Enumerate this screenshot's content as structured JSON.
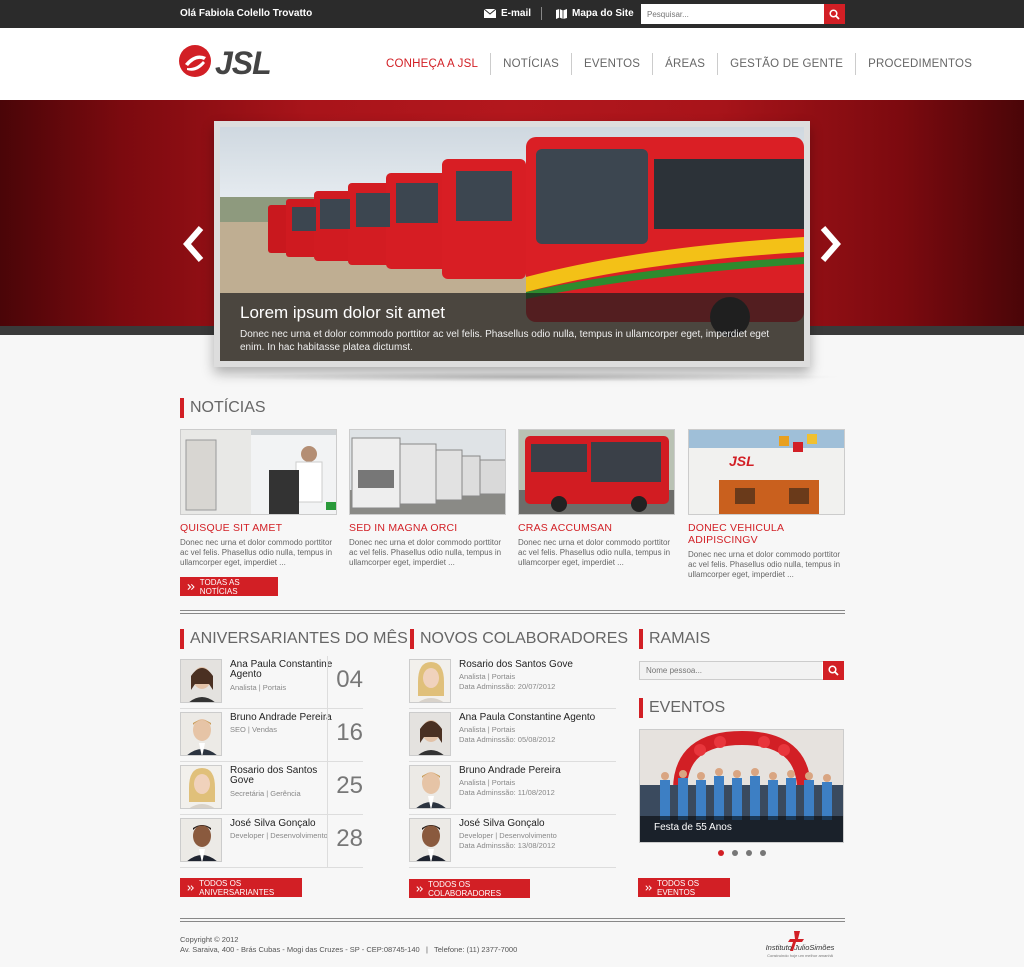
{
  "topbar": {
    "greeting": "Olá Fabiola Colello Trovatto",
    "email_label": "E-mail",
    "sitemap_label": "Mapa do Site",
    "search_placeholder": "Pesquisar..."
  },
  "nav": {
    "items": [
      "CONHEÇA A JSL",
      "NOTÍCIAS",
      "EVENTOS",
      "ÁREAS",
      "GESTÃO DE GENTE",
      "PROCEDIMENTOS"
    ]
  },
  "slider": {
    "title": "Lorem ipsum dolor sit amet",
    "text": "Donec nec urna et dolor commodo porttitor ac vel felis. Phasellus odio nulla, tempus in ullamcorper eget, imperdiet eget enim. In hac habitasse platea dictumst."
  },
  "news": {
    "title": "NOTÍCIAS",
    "items": [
      {
        "title": "QUISQUE SIT AMET",
        "text": "Donec nec urna et dolor commodo porttitor ac vel felis. Phasellus odio nulla, tempus in ullamcorper eget, imperdiet ..."
      },
      {
        "title": "SED IN MAGNA ORCI",
        "text": "Donec nec urna et dolor commodo porttitor ac vel felis. Phasellus odio nulla, tempus in ullamcorper eget, imperdiet ..."
      },
      {
        "title": "CRAS ACCUMSAN",
        "text": "Donec nec urna et dolor commodo porttitor ac vel felis. Phasellus odio nulla, tempus in ullamcorper eget, imperdiet ..."
      },
      {
        "title": "DONEC VEHICULA ADIPISCINGV",
        "text": "Donec nec urna et dolor commodo porttitor ac vel felis. Phasellus odio nulla, tempus in ullamcorper eget, imperdiet ..."
      }
    ],
    "all_button": "TODAS AS NOTÍCIAS"
  },
  "birthdays": {
    "title": "ANIVERSARIANTES DO MÊS",
    "items": [
      {
        "name": "Ana Paula Constantine Agento",
        "role": "Analista | Portais",
        "day": "04"
      },
      {
        "name": "Bruno Andrade Pereira",
        "role": "SEO | Vendas",
        "day": "16"
      },
      {
        "name": "Rosario dos Santos Gove",
        "role": "Secretária | Gerência",
        "day": "25"
      },
      {
        "name": "José Silva Gonçalo",
        "role": "Developer | Desenvolvimento",
        "day": "28"
      }
    ],
    "all_button": "TODOS OS ANIVERSARIANTES"
  },
  "newcomers": {
    "title": "NOVOS COLABORADORES",
    "items": [
      {
        "name": "Rosario dos Santos Gove",
        "role": "Analista | Portais",
        "date": "Data Adminssão: 20/07/2012"
      },
      {
        "name": "Ana Paula Constantine Agento",
        "role": "Analista | Portais",
        "date": "Data Adminssão: 05/08/2012"
      },
      {
        "name": "Bruno Andrade Pereira",
        "role": "Analista | Portais",
        "date": "Data Adminssão: 11/08/2012"
      },
      {
        "name": "José Silva Gonçalo",
        "role": "Developer | Desenvolvimento",
        "date": "Data Adminssão: 13/08/2012"
      }
    ],
    "all_button": "TODOS OS COLABORADORES"
  },
  "ramais": {
    "title": "RAMAIS",
    "placeholder": "Nome pessoa..."
  },
  "events": {
    "title": "EVENTOS",
    "caption": "Festa de 55 Anos",
    "all_button": "TODOS OS EVENTOS"
  },
  "footer": {
    "copyright": "Copyright © 2012",
    "address": "Av. Saraiva, 400 - Brás Cubas - Mogi das Cruzes - SP - CEP:08745-140   |   Telefone: (11) 2377-7000",
    "logo_text": "Instituto JulioSimões",
    "logo_tagline": "Construindo hoje um melhor amanhã"
  },
  "colors": {
    "accent": "#d21f25",
    "topbar": "#2b2b2b"
  }
}
